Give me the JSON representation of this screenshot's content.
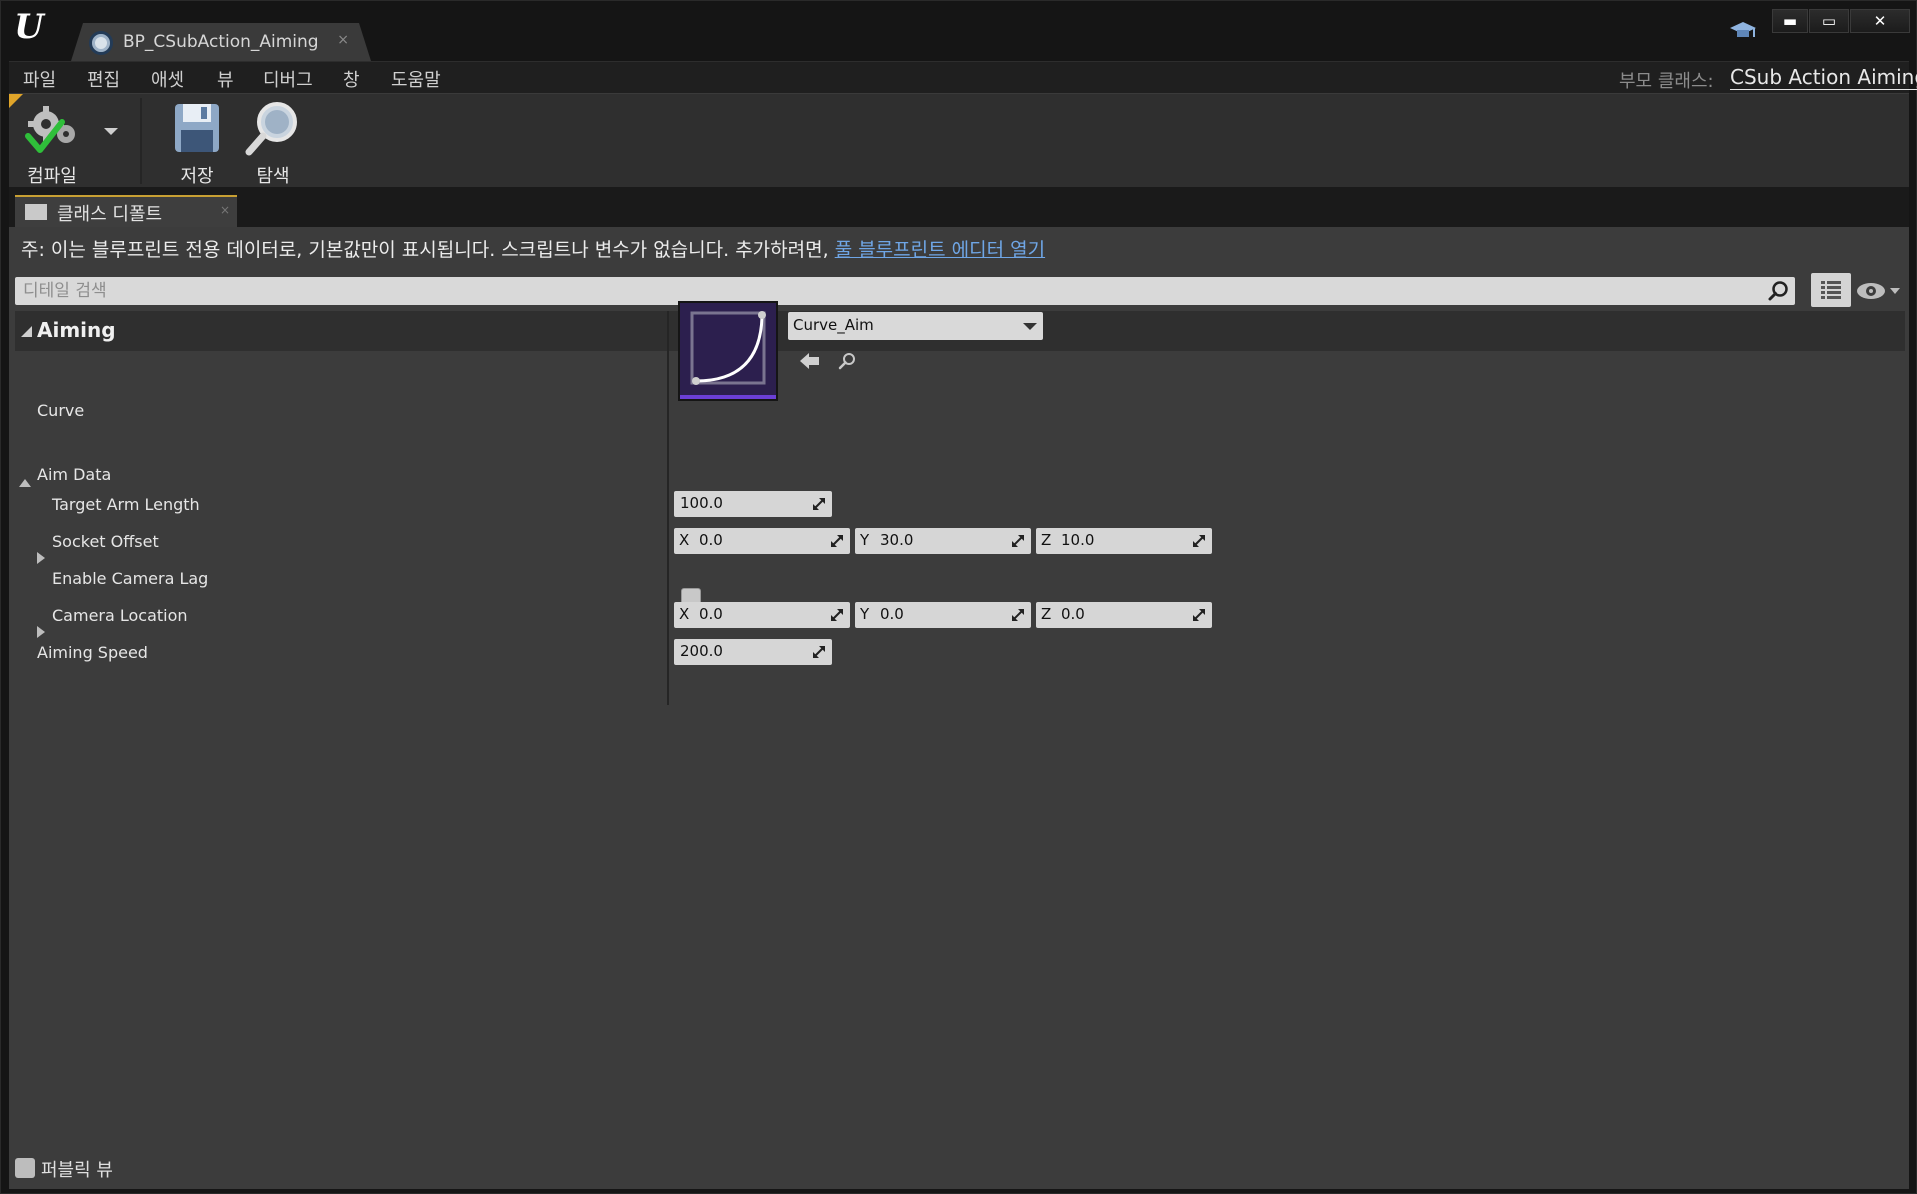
{
  "window": {
    "tab_title": "BP_CSubAction_Aiming",
    "tab_close": "×",
    "min_glyph": "▬",
    "max_glyph": "▭",
    "close_glyph": "✕"
  },
  "menu": {
    "items": [
      "파일",
      "편집",
      "애셋",
      "뷰",
      "디버그",
      "창",
      "도움말"
    ],
    "parent_class_label": "부모 클래스:",
    "parent_class_value": "CSub Action Aiming"
  },
  "toolbar": {
    "compile_label": "컴파일",
    "save_label": "저장",
    "browse_label": "탐색"
  },
  "panel": {
    "tab_label": "클래스 디폴트",
    "tab_close": "×",
    "notice_text": "주: 이는 블루프린트 전용 데이터로, 기본값만이 표시됩니다. 스크립트나 변수가 없습니다. 추가하려면, ",
    "notice_link": "풀 블루프린트 에디터 열기",
    "search_placeholder": "디테일 검색"
  },
  "details": {
    "category": "Aiming",
    "curve": {
      "label": "Curve",
      "value": "Curve_Aim"
    },
    "aim_data": {
      "label": "Aim Data",
      "target_arm_length": {
        "label": "Target Arm Length",
        "value": "100.0"
      },
      "socket_offset": {
        "label": "Socket Offset",
        "x": "0.0",
        "y": "30.0",
        "z": "10.0"
      },
      "enable_camera_lag": {
        "label": "Enable Camera Lag",
        "checked": false
      },
      "camera_location": {
        "label": "Camera Location",
        "x": "0.0",
        "y": "0.0",
        "z": "0.0"
      }
    },
    "aiming_speed": {
      "label": "Aiming Speed",
      "value": "200.0"
    },
    "axis": {
      "x": "X",
      "y": "Y",
      "z": "Z"
    }
  },
  "footer": {
    "public_view_label": "퍼블릭 뷰",
    "checked": false
  },
  "colors": {
    "accent_link": "#6fa6e6",
    "curve_thumb_bg": "#2c1f4e",
    "curve_bar": "#6b3fd6",
    "tab_highlight": "#c8a033"
  }
}
